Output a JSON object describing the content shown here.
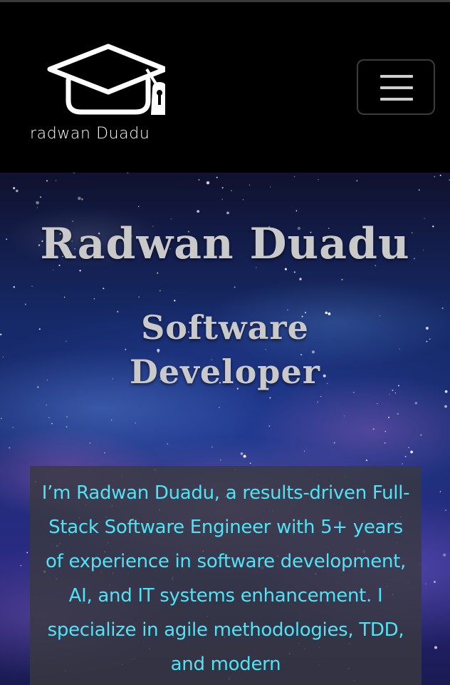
{
  "navbar": {
    "brand_text": "radwan Duadu",
    "logo_icon": "graduation-cap-icon",
    "menu_icon": "hamburger-menu-icon"
  },
  "hero": {
    "name": "Radwan Duadu",
    "role_line1": "Software",
    "role_line2": "Developer",
    "about": "I’m Radwan Duadu, a results-driven Full-Stack Software Engineer with 5+ years of experience in software development, AI, and IT systems enhancement. I specialize in agile methodologies, TDD, and modern"
  },
  "colors": {
    "navbar_background": "#000000",
    "heading_text": "#c9c9c9",
    "about_text": "#4fe3f5",
    "about_card_background": "#3a3a3e"
  }
}
